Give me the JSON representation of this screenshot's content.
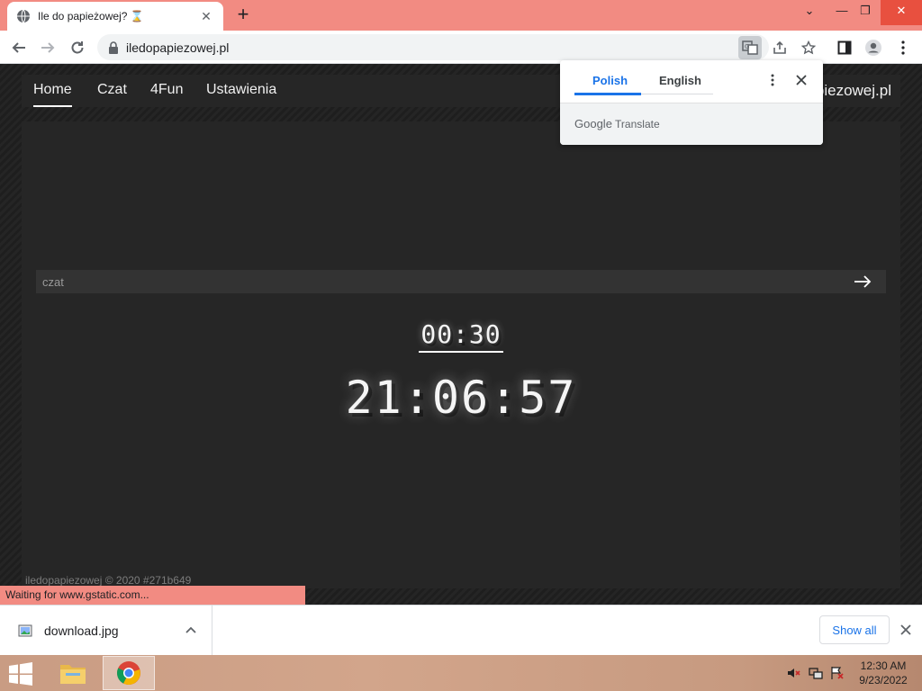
{
  "browser": {
    "tab_title": "Ile do papieżowej? ⌛",
    "url": "iledopapiezowej.pl",
    "status_text": "Waiting for www.gstatic.com..."
  },
  "site": {
    "nav": [
      "Home",
      "Czat",
      "4Fun",
      "Ustawienia"
    ],
    "brand": "iledopapiezowej.pl",
    "chat_placeholder": "czat",
    "countdown": "00:30",
    "clock": "21:06:57",
    "footer": "iledopapiezowej © 2020 #271b649"
  },
  "translate_popup": {
    "tabs": [
      "Polish",
      "English"
    ],
    "active_tab": "Polish",
    "footer_brand": "Google",
    "footer_text": "Translate"
  },
  "downloads": {
    "file_name": "download.jpg",
    "show_all": "Show all"
  },
  "taskbar": {
    "time": "12:30 AM",
    "date": "9/23/2022"
  },
  "colors": {
    "titlebar": "#f28b82",
    "page_bg": "#262626",
    "accent_blue": "#1a73e8"
  },
  "icons": [
    "globe-icon",
    "hourglass-icon",
    "back-icon",
    "forward-icon",
    "reload-icon",
    "lock-icon",
    "translate-icon",
    "share-icon",
    "star-icon",
    "sidebar-icon",
    "profile-icon",
    "kebab-menu-icon",
    "arrow-right-icon",
    "image-file-icon",
    "chevron-up-icon",
    "close-icon",
    "windows-start-icon",
    "file-explorer-icon",
    "chrome-icon",
    "speaker-muted-icon",
    "network-icon",
    "flag-icon"
  ]
}
